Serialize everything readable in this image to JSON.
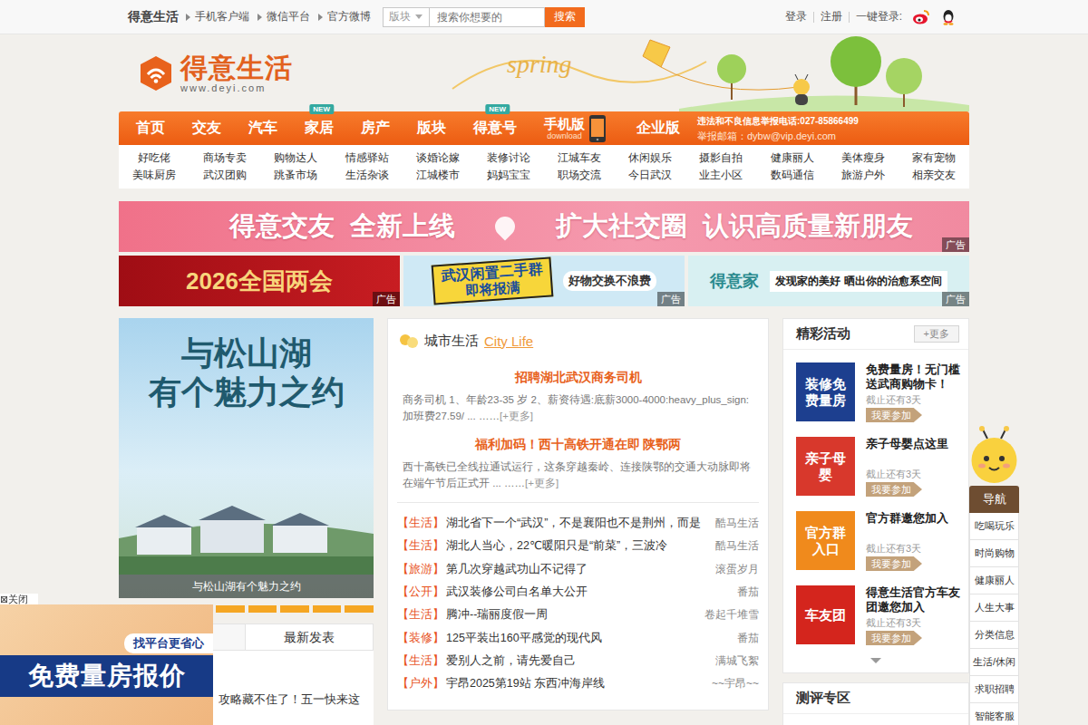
{
  "topbar": {
    "brand": "得意生活",
    "links": [
      "手机客户端",
      "微信平台",
      "官方微博"
    ],
    "search": {
      "scope": "版块",
      "placeholder": "搜索你想要的",
      "button": "搜索"
    },
    "account": {
      "login": "登录",
      "register": "注册",
      "quick": "一键登录:"
    }
  },
  "logo": {
    "name": "得意生活",
    "url": "www.deyi.com"
  },
  "header_art": {
    "word": "spring"
  },
  "nav": {
    "items": [
      {
        "label": "首页",
        "badge": "",
        "sub": ""
      },
      {
        "label": "交友",
        "badge": "",
        "sub": ""
      },
      {
        "label": "汽车",
        "badge": "",
        "sub": ""
      },
      {
        "label": "家居",
        "badge": "NEW",
        "sub": ""
      },
      {
        "label": "房产",
        "badge": "",
        "sub": ""
      },
      {
        "label": "版块",
        "badge": "",
        "sub": ""
      },
      {
        "label": "得意号",
        "badge": "NEW",
        "sub": ""
      },
      {
        "label": "手机版",
        "badge": "",
        "sub": "download"
      },
      {
        "label": "企业版",
        "badge": "",
        "sub": ""
      }
    ],
    "report": {
      "phone": "违法和不良信息举报电话:027-85866499",
      "email": "举报邮箱：dybw@vip.deyi.com"
    }
  },
  "subnav": [
    [
      "好吃佬",
      "商场专卖",
      "购物达人",
      "情感驿站",
      "谈婚论嫁",
      "装修讨论",
      "江城车友",
      "休闲娱乐",
      "摄影自拍",
      "健康丽人",
      "美体瘦身",
      "家有宠物"
    ],
    [
      "美味厨房",
      "武汉团购",
      "跳蚤市场",
      "生活杂谈",
      "江城楼市",
      "妈妈宝宝",
      "职场交流",
      "今日武汉",
      "业主小区",
      "数码通信",
      "旅游户外",
      "相亲交友"
    ]
  ],
  "ads": {
    "tag": "广告",
    "banner": {
      "left": "得意交友  全新上线",
      "right": "扩大社交圈  认识高质量新朋友"
    },
    "strip": [
      {
        "kind": "red",
        "lines": [
          "2026全国两会"
        ]
      },
      {
        "kind": "blue",
        "lines": [
          "武汉闲置二手群",
          "即将报满",
          "好物交换不浪费"
        ]
      },
      {
        "kind": "aqua",
        "lines": [
          "得意家",
          "发现家的美好 晒出你的治愈系空间"
        ]
      }
    ]
  },
  "focus": {
    "headline": [
      "与松山湖",
      "有个魅力之约"
    ],
    "caption": "与松山湖有个魅力之约",
    "dots": [
      {
        "selected": true
      },
      {
        "selected": false
      },
      {
        "selected": false
      },
      {
        "selected": false
      },
      {
        "selected": false
      },
      {
        "selected": false
      },
      {
        "selected": false
      },
      {
        "selected": false
      }
    ]
  },
  "left_tabs": [
    {
      "label": "最新发表",
      "selected": false
    }
  ],
  "left_list": [
    "攻略藏不住了！五一快来这"
  ],
  "city": {
    "title": "城市生活",
    "subtitle": "City Life",
    "featured": [
      {
        "title": "招聘湖北武汉商务司机",
        "desc": "商务司机 1、年龄23-35 岁 2、薪资待遇:底薪3000-4000:heavy_plus_sign:加班费27.59/ ... ……",
        "more": "[+更多]"
      },
      {
        "title": "福利加码！西十高铁开通在即 陕鄂两",
        "desc": "西十高铁已全线拉通试运行，这条穿越秦岭、连接陕鄂的交通大动脉即将在端午节后正式开 ... ……",
        "more": "[+更多]"
      }
    ],
    "posts": [
      {
        "tag": "【生活】",
        "title": "湖北省下一个“武汉”，不是襄阳也不是荆州，而是",
        "author": "酷马生活"
      },
      {
        "tag": "【生活】",
        "title": "湖北人当心，22℃暖阳只是“前菜”，三波冷",
        "author": "酷马生活"
      },
      {
        "tag": "【旅游】",
        "title": "第几次穿越武功山不记得了",
        "author": "滚蛋岁月"
      },
      {
        "tag": "【公开】",
        "title": "武汉装修公司白名单大公开",
        "author": "番茄"
      },
      {
        "tag": "【生活】",
        "title": "腾冲--瑞丽度假一周",
        "author": "卷起千堆雪"
      },
      {
        "tag": "【装修】",
        "title": "125平装出160平感觉的现代风",
        "author": "番茄"
      },
      {
        "tag": "【生活】",
        "title": "爱别人之前，请先爱自己",
        "author": "满城飞絮"
      },
      {
        "tag": "【户外】",
        "title": "宇昂2025第19站 东西冲海岸线",
        "author": "~~宇昂~~"
      }
    ]
  },
  "events": {
    "title": "精彩活动",
    "more": "+更多",
    "items": [
      {
        "title": "免费量房！无门槛送武商购物卡！",
        "thumb": "装修免费量房",
        "color": "#1d3f8f",
        "deadline": "截止还有3天",
        "join": "我要参加"
      },
      {
        "title": "亲子母婴点这里",
        "thumb": "亲子母婴",
        "color": "#d8382c",
        "deadline": "截止还有3天",
        "join": "我要参加"
      },
      {
        "title": "官方群邀您加入",
        "thumb": "官方群入口",
        "color": "#f08a1c",
        "deadline": "截止还有3天",
        "join": "我要参加"
      },
      {
        "title": "得意生活官方车友团邀您加入",
        "thumb": "车友团",
        "color": "#d4251d",
        "deadline": "截止还有3天",
        "join": "我要参加"
      }
    ]
  },
  "review": {
    "title": "测评专区"
  },
  "float_nav": {
    "title": "导航",
    "items": [
      "吃喝玩乐",
      "时尚购物",
      "健康丽人",
      "人生大事",
      "分类信息",
      "生活/休闲",
      "求职招聘",
      "智能客服"
    ]
  },
  "float_ad": {
    "close_icon": "⊠",
    "close": "关闭",
    "lines": [
      "找平台更省心",
      "免费量房报价"
    ]
  }
}
